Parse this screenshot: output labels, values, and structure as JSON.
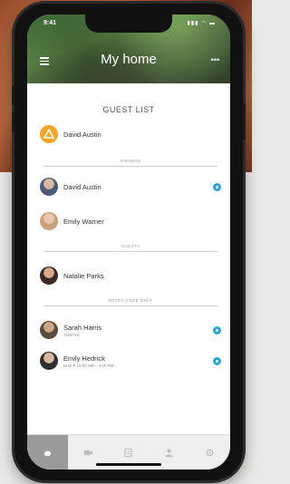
{
  "app": {
    "title": "My home",
    "status_time": "9:41",
    "status_icons": "▮▮▮ ◠ ▬"
  },
  "guest_list": {
    "heading": "GUEST LIST",
    "primary_owner": "David Austin",
    "sections": {
      "owners": "OWNERS",
      "guests": "GUESTS",
      "entry_code_only": "ENTRY CODE ONLY"
    },
    "owners": [
      {
        "name": "David Austin",
        "badge": true
      },
      {
        "name": "Emily Warner",
        "badge": false
      }
    ],
    "guests": [
      {
        "name": "Natalie Parks"
      }
    ],
    "entry_code_only": [
      {
        "name": "Sarah Harris",
        "detail": "ALWAYS",
        "badge": true
      },
      {
        "name": "Emily Hedrick",
        "detail": "M W F 10:00 AM – 4:00 PM",
        "badge": true
      }
    ]
  },
  "tabs": [
    {
      "icon": "home-icon",
      "active": true
    },
    {
      "icon": "camera-icon",
      "active": false
    },
    {
      "icon": "activity-icon",
      "active": false
    },
    {
      "icon": "guests-icon",
      "active": false
    },
    {
      "icon": "settings-icon",
      "active": false
    }
  ],
  "colors": {
    "accent": "#2ba3d8",
    "owner": "#f4a52a"
  }
}
